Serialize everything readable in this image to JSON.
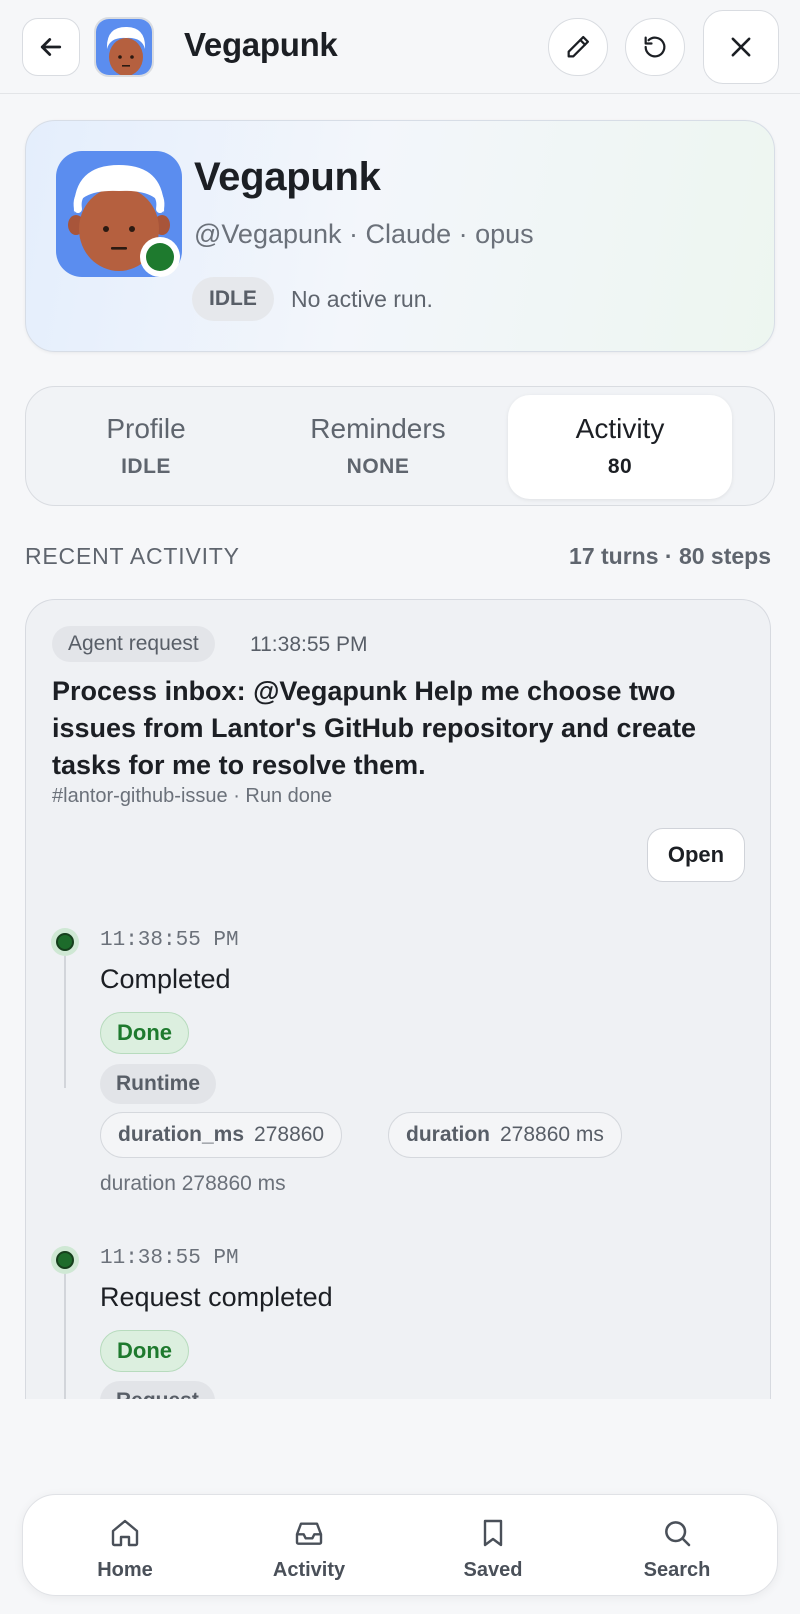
{
  "header": {
    "title": "Vegapunk",
    "back_icon": "arrow-left-icon",
    "edit_icon": "pencil-icon",
    "refresh_icon": "refresh-icon",
    "close_icon": "close-icon"
  },
  "profile": {
    "name": "Vegapunk",
    "subtitle": "@Vegapunk · Claude · opus",
    "status_badge": "IDLE",
    "status_text": "No active run.",
    "online_color": "#1e7a2e"
  },
  "tabs": [
    {
      "label": "Profile",
      "sub": "IDLE",
      "active": false
    },
    {
      "label": "Reminders",
      "sub": "NONE",
      "active": false
    },
    {
      "label": "Activity",
      "sub": "80",
      "active": true
    }
  ],
  "recent": {
    "title": "RECENT ACTIVITY",
    "meta": "17 turns · 80 steps"
  },
  "request": {
    "badge": "Agent request",
    "time": "11:38:55 PM",
    "text": "Process inbox: @Vegapunk Help me choose two issues from Lantor's GitHub repository and create tasks for me to resolve them.",
    "meta": "#lantor-github-issue · Run done",
    "open_label": "Open"
  },
  "timeline": [
    {
      "time": "11:38:55 PM",
      "title": "Completed",
      "status": "Done",
      "category": "Runtime",
      "chips": [
        {
          "key": "duration_ms",
          "value": "278860"
        },
        {
          "key": "duration",
          "value": "278860 ms"
        }
      ],
      "note": "duration 278860 ms"
    },
    {
      "time": "11:38:55 PM",
      "title": "Request completed",
      "status": "Done",
      "category": "Request"
    }
  ],
  "nav": [
    {
      "label": "Home",
      "icon": "home-icon"
    },
    {
      "label": "Activity",
      "icon": "inbox-icon"
    },
    {
      "label": "Saved",
      "icon": "bookmark-icon"
    },
    {
      "label": "Search",
      "icon": "search-icon"
    }
  ]
}
